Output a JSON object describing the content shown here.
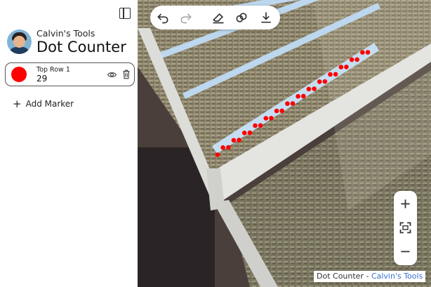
{
  "app": {
    "subtitle": "Calvin's Tools",
    "title": "Dot Counter"
  },
  "markers": [
    {
      "name": "Top Row 1",
      "count": "29",
      "color": "#ff0000"
    }
  ],
  "add_marker_label": "Add Marker",
  "footer": {
    "prefix": "Dot Counter - ",
    "link": "Calvin's Tools"
  },
  "icons": {
    "sidebar_toggle": "sidebar-toggle-icon",
    "visibility": "eye-icon",
    "delete": "trash-icon",
    "undo": "undo-icon",
    "redo": "redo-icon",
    "eraser": "eraser-icon",
    "lasso": "lasso-icon",
    "download": "download-icon",
    "zoom_in": "plus-icon",
    "fit": "fit-screen-icon",
    "zoom_out": "minus-icon"
  }
}
